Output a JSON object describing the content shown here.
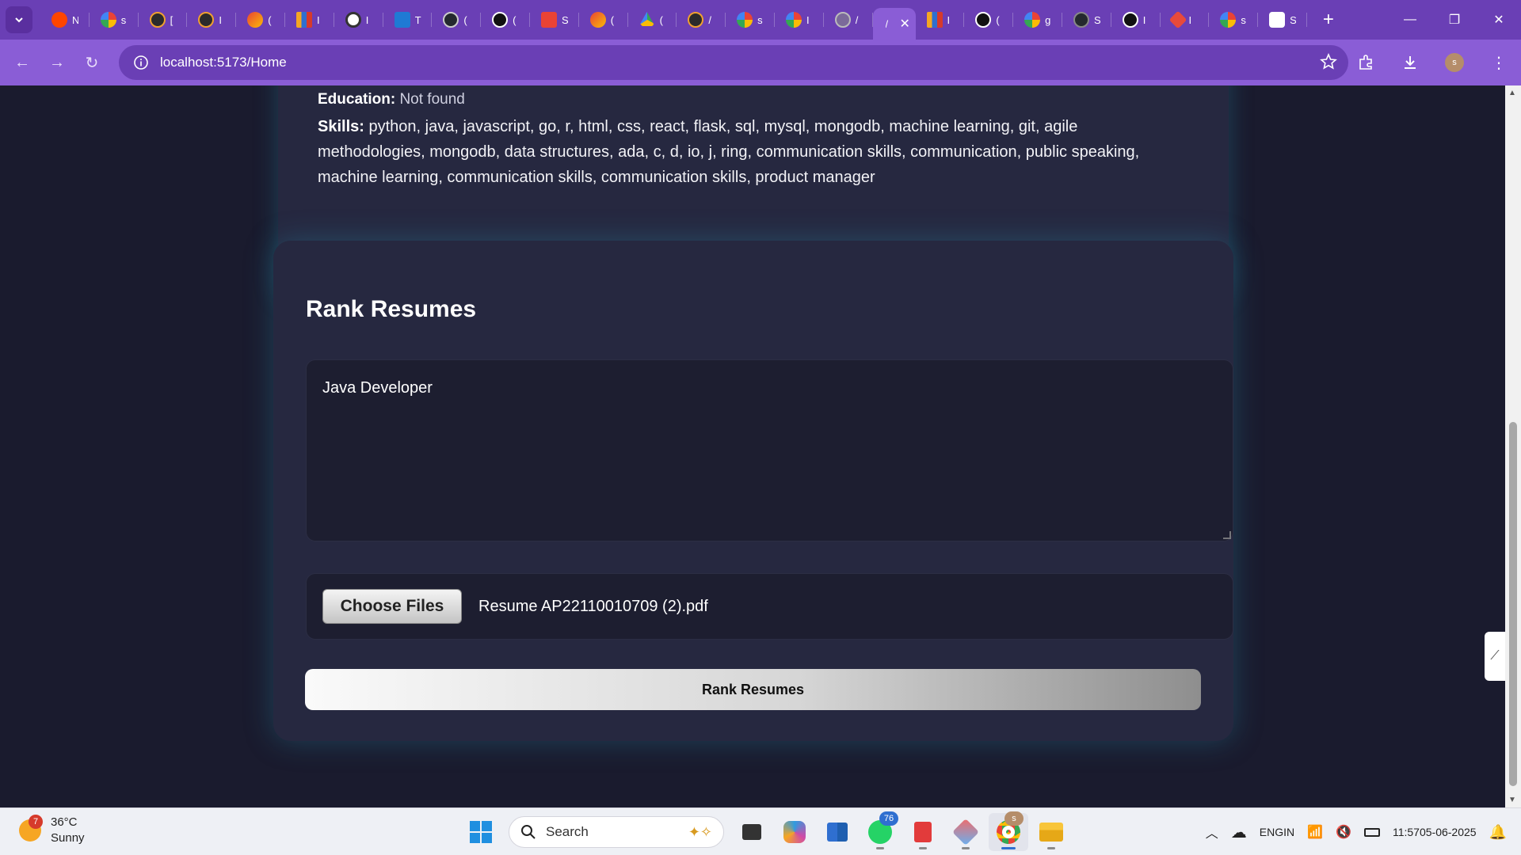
{
  "browser": {
    "active_tab_title": "/",
    "tab_letters": [
      "N",
      "s",
      "[",
      "I",
      "(",
      "I",
      "I",
      "T",
      "(",
      "(",
      "S",
      "(",
      "(",
      "/",
      "s",
      "I",
      "/",
      "I",
      "(",
      "g",
      "S",
      "I",
      "I",
      "s",
      "S"
    ],
    "url": "localhost:5173/Home",
    "profile_initial": "s"
  },
  "profile_card": {
    "education_label": "Education:",
    "education_value": "Not found",
    "skills_label": "Skills:",
    "skills_value": "python, java, javascript, go, r, html, css, react, flask, sql, mysql, mongodb, machine learning, git, agile methodologies, mongodb, data structures, ada, c, d, io, j, ring, communication skills, communication, public speaking, machine learning, communication skills, communication skills, product manager"
  },
  "rank": {
    "title": "Rank Resumes",
    "job_description": "Java Developer",
    "choose_files_label": "Choose Files",
    "file_name": "Resume AP22110010709 (2).pdf",
    "submit_label": "Rank Resumes"
  },
  "taskbar": {
    "weather_badge": "7",
    "temperature": "36°C",
    "condition": "Sunny",
    "search_placeholder": "Search",
    "whatsapp_badge": "76",
    "chrome_badge": "s",
    "lang_line1": "ENG",
    "lang_line2": "IN",
    "time": "11:57",
    "date": "05-06-2025"
  },
  "colors": {
    "tab_bar": "#6a3fb5",
    "address_bar": "#8a5dd6",
    "page_bg": "#1a1b2e",
    "card_bg": "#262840"
  }
}
